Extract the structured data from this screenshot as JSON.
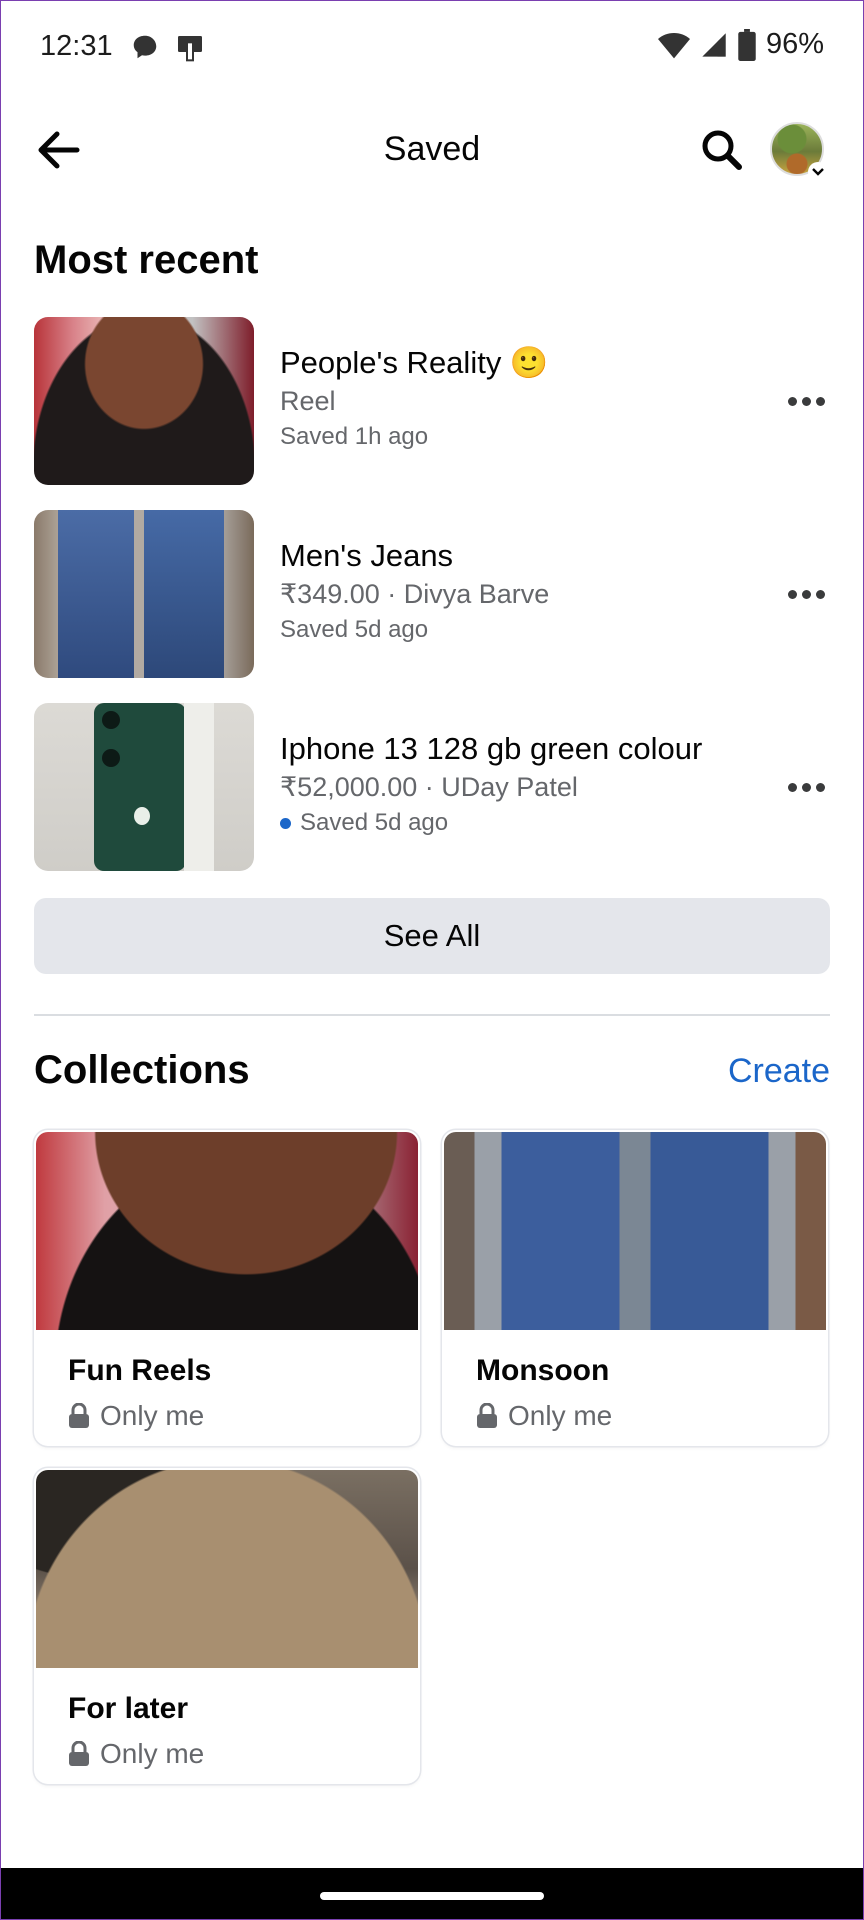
{
  "status_bar": {
    "time": "12:31",
    "battery": "96%",
    "icons": [
      "chat-bubble-icon",
      "device-icon",
      "wifi-icon",
      "signal-icon",
      "battery-icon"
    ]
  },
  "header": {
    "title": "Saved",
    "back_icon": "arrow-left-icon",
    "search_icon": "search-icon"
  },
  "recent": {
    "heading": "Most recent",
    "items": [
      {
        "title": "People's Reality 🙂",
        "subtitle": "Reel",
        "meta": "Saved 1h ago",
        "unread": false
      },
      {
        "title": "Men's Jeans",
        "subtitle": "₹349.00 · Divya Barve",
        "meta": "Saved 5d ago",
        "unread": false
      },
      {
        "title": "Iphone 13 128 gb green colour",
        "subtitle": "₹52,000.00 · UDay Patel",
        "meta": "Saved 5d ago",
        "unread": true
      }
    ],
    "see_all": "See All"
  },
  "collections": {
    "heading": "Collections",
    "create": "Create",
    "cards": [
      {
        "name": "Fun Reels",
        "privacy": "Only me"
      },
      {
        "name": "Monsoon",
        "privacy": "Only me"
      },
      {
        "name": "For later",
        "privacy": "Only me"
      }
    ]
  },
  "colors": {
    "accent": "#1b66c9",
    "secondary_text": "#65676b",
    "button_bg": "#e4e6eb"
  }
}
